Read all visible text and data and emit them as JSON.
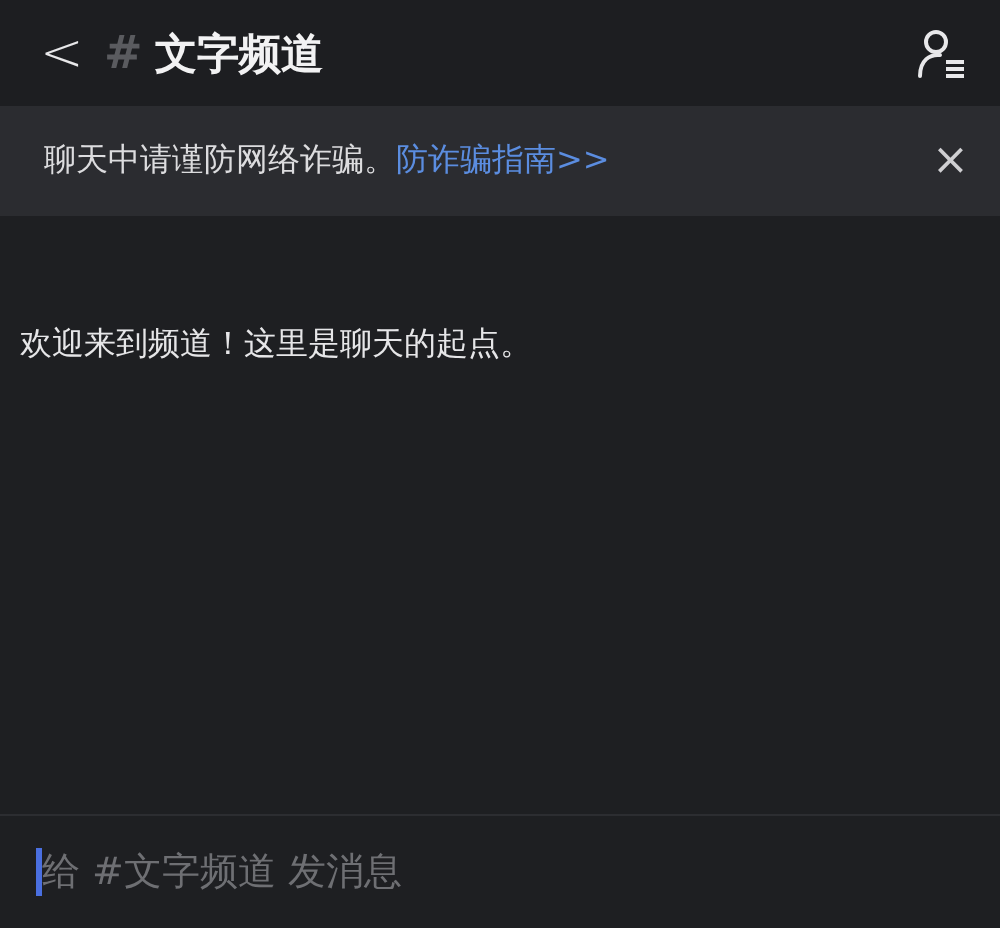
{
  "header": {
    "back": "<",
    "hash": "#",
    "title": "文字频道"
  },
  "notice": {
    "text": "聊天中请谨防网络诈骗。",
    "link": "防诈骗指南>>",
    "close": "×"
  },
  "messages": [
    {
      "text": "欢迎来到频道！这里是聊天的起点。"
    }
  ],
  "composer": {
    "placeholder": "给 #文字频道 发消息"
  }
}
